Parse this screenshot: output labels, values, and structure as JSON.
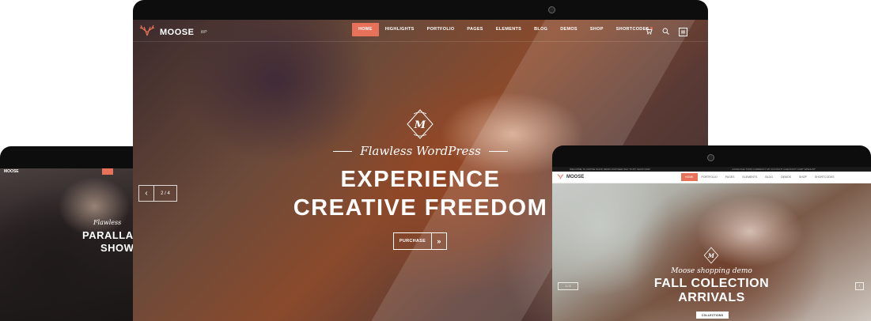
{
  "main": {
    "logo": "MOOSE",
    "logo_sup": "WP",
    "nav": [
      "HOME",
      "HIGHLIGHTS",
      "PORTFOLIO",
      "PAGES",
      "ELEMENTS",
      "BLOG",
      "DEMOS",
      "SHOP",
      "SHORTCODES"
    ],
    "emblem_letter": "M",
    "tagline": "Flawless WordPress",
    "headline_line1": "EXPERIENCE",
    "headline_line2": "CREATIVE FREEDOM",
    "purchase_label": "PURCHASE",
    "slider_counter": "2 / 4",
    "accent": "#e8715a"
  },
  "left": {
    "logo": "MOOSE",
    "tagline": "Flawless",
    "headline_line1": "PARALLA",
    "headline_line2": "SHOW"
  },
  "right": {
    "logo": "MOOSE",
    "topbar_message": "WELCOME TO MOOSE SHOP, DEMO ANOTHER WAY TO BY SHOP NOW",
    "topbar_links": "LANGUAGE   TURN   CURRENCY   MY ACCOUNT   CHECKOUT   CART   WISHLIST",
    "nav": [
      "HOME",
      "PORTFOLIO",
      "PAGES",
      "ELEMENTS",
      "BLOG",
      "DEMOS",
      "SHOP",
      "SHORTCODES"
    ],
    "emblem_letter": "M",
    "tagline": "Moose shopping demo",
    "headline_line1": "FALL COLECTION",
    "headline_line2": "ARRIVALS",
    "button_label": "COLLECTIONS",
    "slider_counter": "1 / 2"
  }
}
